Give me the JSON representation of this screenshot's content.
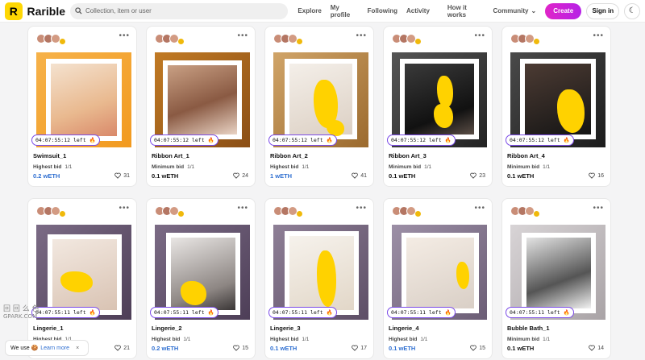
{
  "header": {
    "logo_letter": "R",
    "brand": "Rarible",
    "search_placeholder": "Collection, item or user",
    "nav": [
      "Explore",
      "My profile",
      "Following",
      "Activity",
      "How it works",
      "Community"
    ],
    "create": "Create",
    "signin": "Sign in"
  },
  "cards": [
    {
      "title": "Swimsuit_1",
      "timer": "04:07:55:12 left 🔥",
      "bid_label": "Highest bid",
      "bid_count": "1/1",
      "price": "0.2 wETH",
      "price_blue": true,
      "likes": "31"
    },
    {
      "title": "Ribbon Art_1",
      "timer": "04:07:55:12 left 🔥",
      "bid_label": "Minimum bid",
      "bid_count": "1/1",
      "price": "0.1 wETH",
      "price_blue": false,
      "likes": "24"
    },
    {
      "title": "Ribbon Art_2",
      "timer": "04:07:55:12 left 🔥",
      "bid_label": "Highest bid",
      "bid_count": "1/1",
      "price": "1 wETH",
      "price_blue": true,
      "likes": "41"
    },
    {
      "title": "Ribbon Art_3",
      "timer": "04:07:55:12 left 🔥",
      "bid_label": "Minimum bid",
      "bid_count": "1/1",
      "price": "0.1 wETH",
      "price_blue": false,
      "likes": "23"
    },
    {
      "title": "Ribbon Art_4",
      "timer": "04:07:55:12 left 🔥",
      "bid_label": "Minimum bid",
      "bid_count": "1/1",
      "price": "0.1 wETH",
      "price_blue": false,
      "likes": "16"
    },
    {
      "title": "Lingerie_1",
      "timer": "04:07:55:11 left 🔥",
      "bid_label": "Highest bid",
      "bid_count": "1/1",
      "price": "",
      "price_blue": false,
      "likes": "21"
    },
    {
      "title": "Lingerie_2",
      "timer": "04:07:55:11 left 🔥",
      "bid_label": "Highest bid",
      "bid_count": "1/1",
      "price": "0.2 wETH",
      "price_blue": true,
      "likes": "15"
    },
    {
      "title": "Lingerie_3",
      "timer": "04:07:55:11 left 🔥",
      "bid_label": "Highest bid",
      "bid_count": "1/1",
      "price": "0.1 wETH",
      "price_blue": true,
      "likes": "17"
    },
    {
      "title": "Lingerie_4",
      "timer": "04:07:55:11 left 🔥",
      "bid_label": "Highest bid",
      "bid_count": "1/1",
      "price": "0.1 wETH",
      "price_blue": true,
      "likes": "15"
    },
    {
      "title": "Bubble Bath_1",
      "timer": "04:07:55:11 left 🔥",
      "bid_label": "Minimum bid",
      "bid_count": "1/1",
      "price": "0.1 wETH",
      "price_blue": false,
      "likes": "14"
    }
  ],
  "cookie": {
    "text": "We use 🍪",
    "link": "Learn more",
    "close": "×"
  },
  "watermark": {
    "line1": "回 回 么 色",
    "line2": "GPARK.COM"
  },
  "colors": {
    "accent": "#7b4be8",
    "create_start": "#e025c8",
    "create_end": "#b621e6",
    "logo_bg": "#fed703",
    "link_blue": "#2f6fd1"
  }
}
